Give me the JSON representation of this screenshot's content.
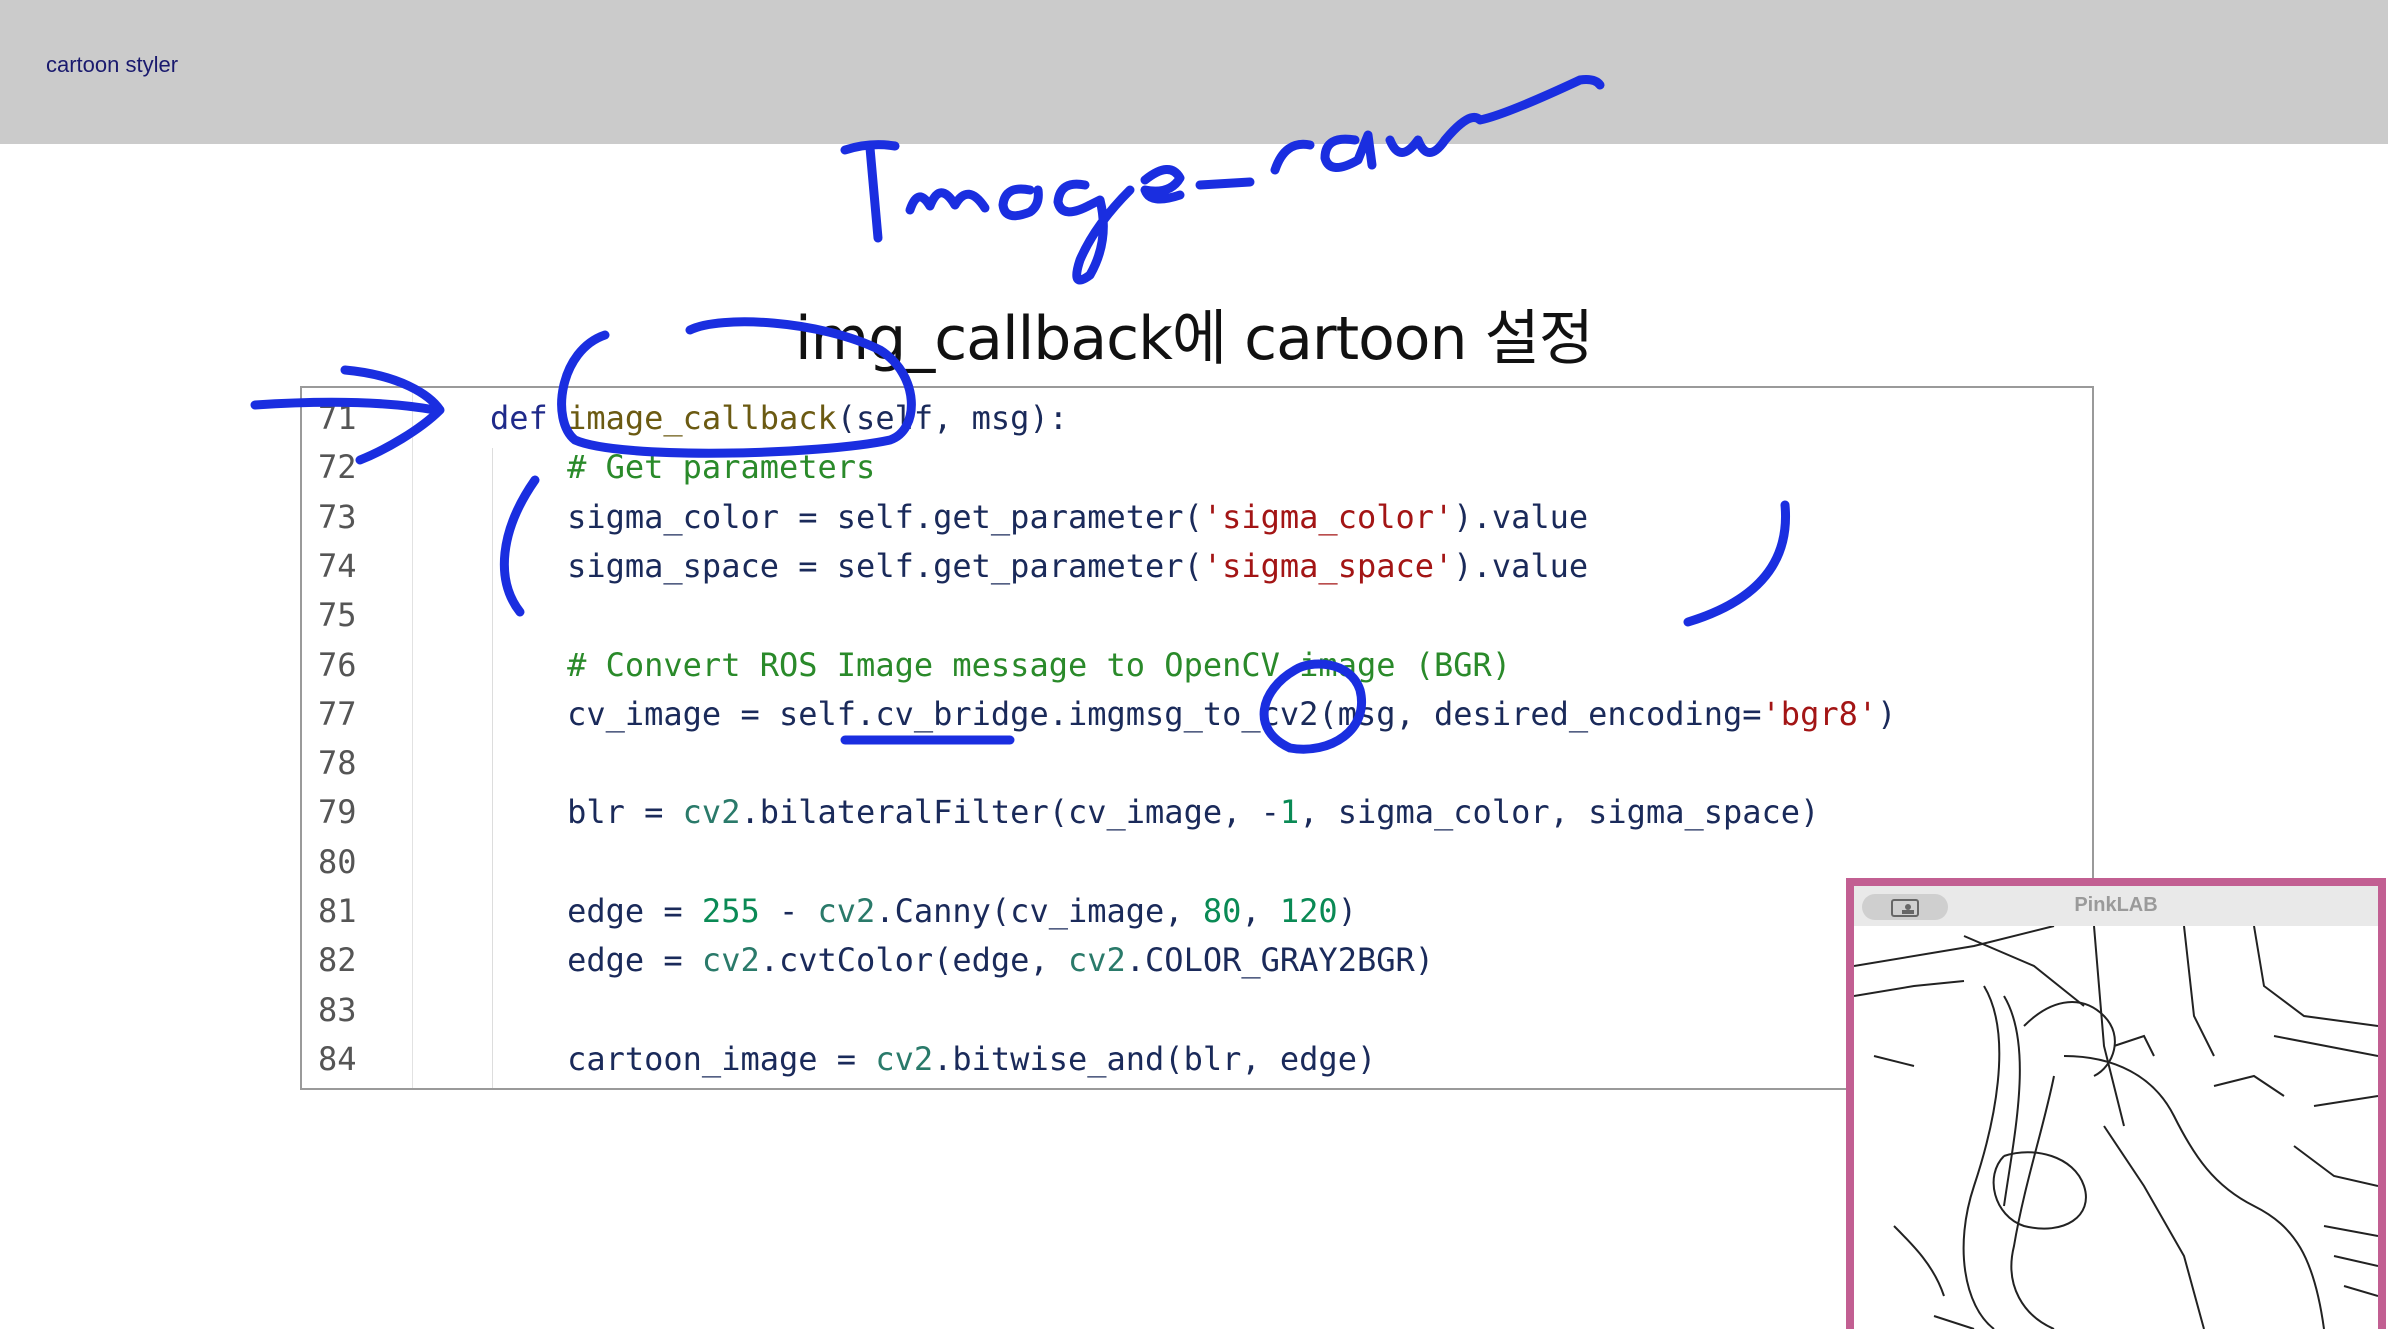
{
  "header": {
    "tab_label": "cartoon styler"
  },
  "slide": {
    "title": "img_callback에 cartoon 설정"
  },
  "code": {
    "lines": [
      {
        "n": "71",
        "segs": [
          [
            "kw",
            "def "
          ],
          [
            "fn",
            "image_callback"
          ],
          [
            "tx",
            "(self, msg):"
          ]
        ]
      },
      {
        "n": "72",
        "segs": [
          [
            "cm",
            "    # Get parameters"
          ]
        ]
      },
      {
        "n": "73",
        "segs": [
          [
            "tx",
            "    sigma_color = self.get_parameter("
          ],
          [
            "str",
            "'sigma_color'"
          ],
          [
            "tx",
            ").value"
          ]
        ]
      },
      {
        "n": "74",
        "segs": [
          [
            "tx",
            "    sigma_space = self.get_parameter("
          ],
          [
            "str",
            "'sigma_space'"
          ],
          [
            "tx",
            ").value"
          ]
        ]
      },
      {
        "n": "75",
        "segs": []
      },
      {
        "n": "76",
        "segs": [
          [
            "cm",
            "    # Convert ROS Image message to OpenCV image (BGR)"
          ]
        ]
      },
      {
        "n": "77",
        "segs": [
          [
            "tx",
            "    cv_image = self.cv_bridge.imgmsg_to_cv2(msg, desired_encoding="
          ],
          [
            "str",
            "'bgr8'"
          ],
          [
            "tx",
            ")"
          ]
        ]
      },
      {
        "n": "78",
        "segs": []
      },
      {
        "n": "79",
        "segs": [
          [
            "tx",
            "    blr = "
          ],
          [
            "md",
            "cv2"
          ],
          [
            "tx",
            ".bilateralFilter(cv_image, -"
          ],
          [
            "num",
            "1"
          ],
          [
            "tx",
            ", sigma_color, sigma_space)"
          ]
        ]
      },
      {
        "n": "80",
        "segs": []
      },
      {
        "n": "81",
        "segs": [
          [
            "tx",
            "    edge = "
          ],
          [
            "num",
            "255"
          ],
          [
            "tx",
            " - "
          ],
          [
            "md",
            "cv2"
          ],
          [
            "tx",
            ".Canny(cv_image, "
          ],
          [
            "num",
            "80"
          ],
          [
            "tx",
            ", "
          ],
          [
            "num",
            "120"
          ],
          [
            "tx",
            ")"
          ]
        ]
      },
      {
        "n": "82",
        "segs": [
          [
            "tx",
            "    edge = "
          ],
          [
            "md",
            "cv2"
          ],
          [
            "tx",
            ".cvtColor(edge, "
          ],
          [
            "md",
            "cv2"
          ],
          [
            "tx",
            ".COLOR_GRAY2BGR)"
          ]
        ]
      },
      {
        "n": "83",
        "segs": []
      },
      {
        "n": "84",
        "segs": [
          [
            "tx",
            "    cartoon_image = "
          ],
          [
            "md",
            "cv2"
          ],
          [
            "tx",
            ".bitwise_and(blr, edge)"
          ]
        ]
      }
    ]
  },
  "pip": {
    "title": "PinkLAB",
    "icon": "camera-share-icon"
  },
  "annotations": {
    "handwriting": "Image_raw",
    "ink_color": "#1a2ee0"
  }
}
